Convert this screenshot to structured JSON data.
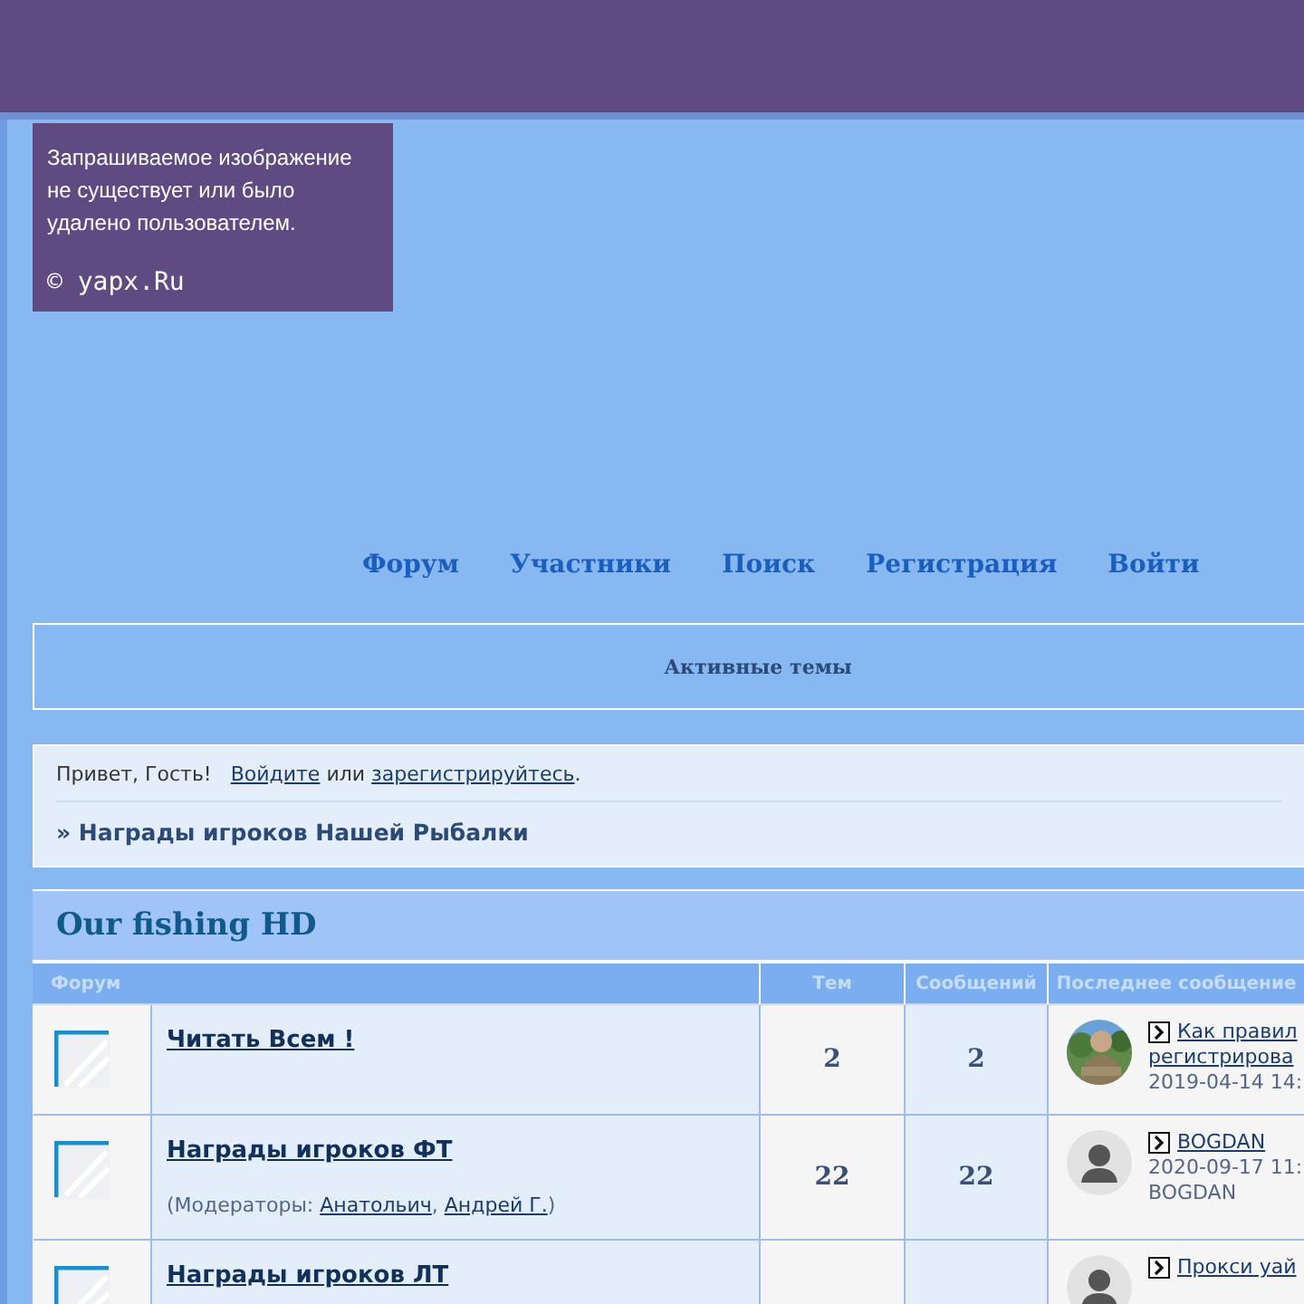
{
  "header_image": {
    "lines": [
      "Запрашиваемое изображение",
      "не существует или было",
      "удалено пользователем."
    ],
    "credit": "© yapx.Ru"
  },
  "nav": [
    "Форум",
    "Участники",
    "Поиск",
    "Регистрация",
    "Войти"
  ],
  "active_topics": "Активные темы",
  "welcome": {
    "greeting": "Привет, Гость!",
    "login": "Войдите",
    "or": "или",
    "register": "зарегистрируйтесь",
    "end": "."
  },
  "breadcrumb": "» Награды игроков Нашей Рыбалки",
  "category": {
    "title": "Our fishing HD",
    "columns": [
      "Форум",
      "Тем",
      "Сообщений",
      "Последнее сообщение"
    ],
    "rows": [
      {
        "title": "Читать Всем !",
        "topics": "2",
        "posts": "2",
        "last_post": {
          "has_photo": true,
          "title_lines": [
            "Как правил",
            "регистрирова"
          ],
          "date": "2019-04-14 14:"
        }
      },
      {
        "title": "Награды игроков ФТ",
        "moderators_prefix": "(Модераторы: ",
        "moderators": [
          "Анатольич",
          "Андрей Г."
        ],
        "moderators_separator": ", ",
        "moderators_suffix": ")",
        "topics": "22",
        "posts": "22",
        "last_post": {
          "has_photo": false,
          "title_lines": [
            "BOGDAN"
          ],
          "date": "2020-09-17 11:",
          "author": "BOGDAN"
        }
      },
      {
        "title": "Награды игроков ЛТ",
        "last_post": {
          "has_photo": false,
          "title_lines": [
            "Прокси уай"
          ]
        }
      }
    ]
  }
}
